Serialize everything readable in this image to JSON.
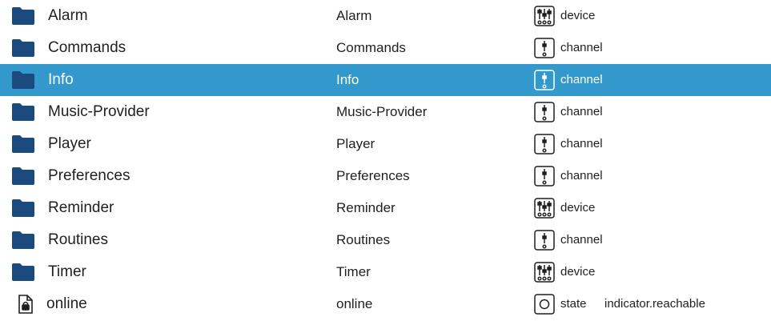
{
  "colors": {
    "selection_bg": "#3399cc",
    "folder": "#1b4a7c",
    "text": "#1f1f1f",
    "selected_text": "#ffffff"
  },
  "rows": [
    {
      "name": "Alarm",
      "col2": "Alarm",
      "type": "device",
      "type_icon": "device-icon",
      "selected": false
    },
    {
      "name": "Commands",
      "col2": "Commands",
      "type": "channel",
      "type_icon": "channel-icon",
      "selected": false
    },
    {
      "name": "Info",
      "col2": "Info",
      "type": "channel",
      "type_icon": "channel-icon",
      "selected": true
    },
    {
      "name": "Music-Provider",
      "col2": "Music-Provider",
      "type": "channel",
      "type_icon": "channel-icon",
      "selected": false
    },
    {
      "name": "Player",
      "col2": "Player",
      "type": "channel",
      "type_icon": "channel-icon",
      "selected": false
    },
    {
      "name": "Preferences",
      "col2": "Preferences",
      "type": "channel",
      "type_icon": "channel-icon",
      "selected": false
    },
    {
      "name": "Reminder",
      "col2": "Reminder",
      "type": "device",
      "type_icon": "device-icon",
      "selected": false
    },
    {
      "name": "Routines",
      "col2": "Routines",
      "type": "channel",
      "type_icon": "channel-icon",
      "selected": false
    },
    {
      "name": "Timer",
      "col2": "Timer",
      "type": "device",
      "type_icon": "device-icon",
      "selected": false
    },
    {
      "name": "online",
      "col2": "online",
      "type": "state",
      "type_icon": "state-icon",
      "role": "indicator.reachable",
      "selected": false
    }
  ]
}
